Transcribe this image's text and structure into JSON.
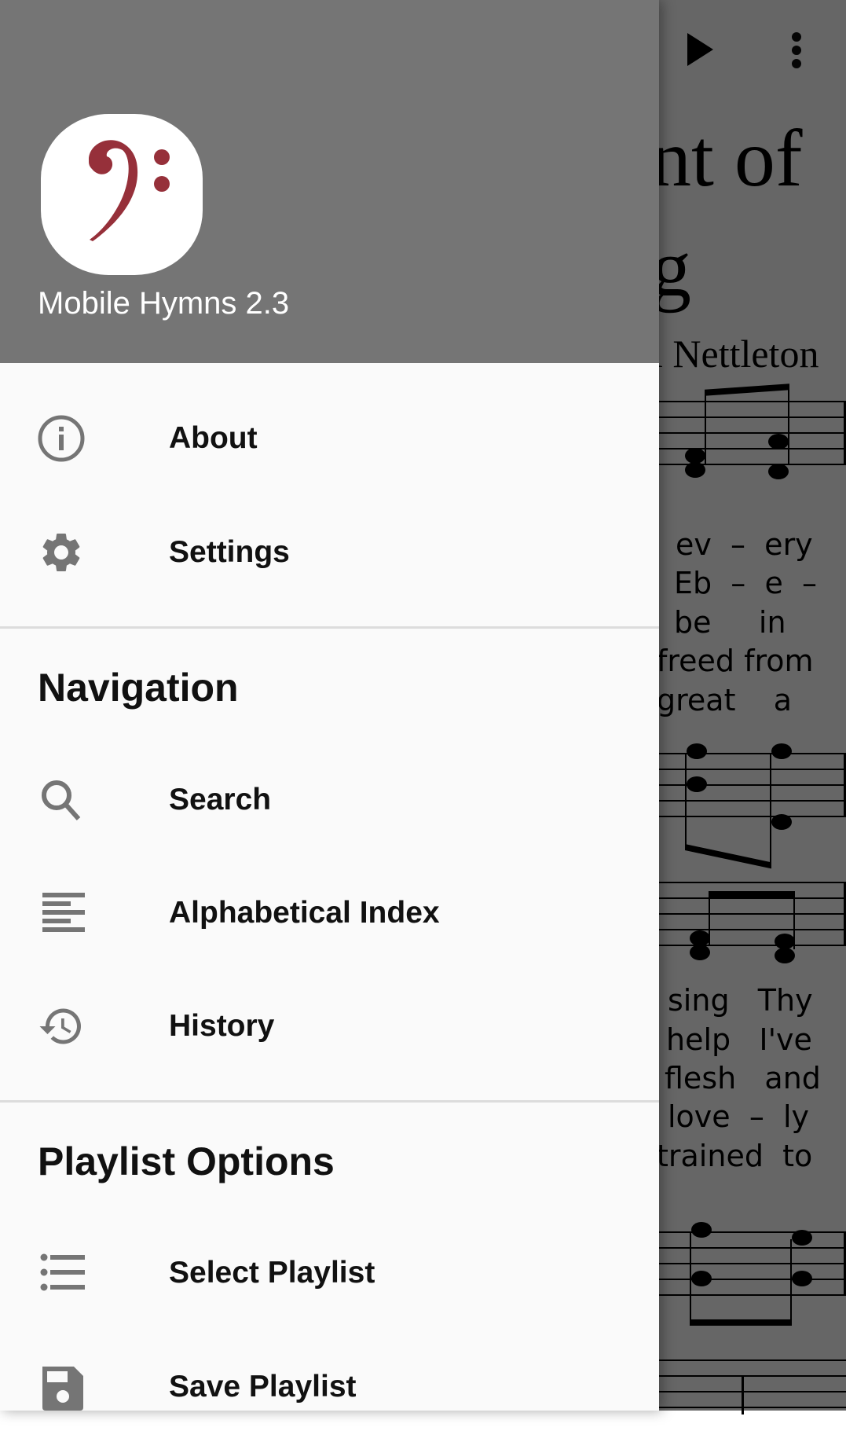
{
  "background_page": {
    "toolbar": {
      "play_icon": "play-icon",
      "overflow_icon": "more-vert-icon"
    },
    "hymn_title_line1": "nt of",
    "hymn_title_line2": "g",
    "hymn_author": "l Nettleton",
    "lyrics_block1": [
      "ev  –  ery",
      "Eb  –  e  –",
      "be     in",
      "freed from",
      "great    a"
    ],
    "lyrics_block2": [
      "sing   Thy",
      "help   I've",
      "flesh   and",
      "love  –  ly",
      "trained  to"
    ]
  },
  "drawer": {
    "header": {
      "app_icon": "bass-clef-icon",
      "app_icon_color": "#96303a",
      "title": "Mobile Hymns 2.3",
      "background_color": "#757575"
    },
    "top_items": [
      {
        "label": "About",
        "icon": "info-icon"
      },
      {
        "label": "Settings",
        "icon": "gear-icon"
      }
    ],
    "sections": [
      {
        "title": "Navigation",
        "items": [
          {
            "label": "Search",
            "icon": "search-icon"
          },
          {
            "label": "Alphabetical Index",
            "icon": "text-align-left-icon"
          },
          {
            "label": "History",
            "icon": "history-icon"
          }
        ]
      },
      {
        "title": "Playlist Options",
        "items": [
          {
            "label": "Select Playlist",
            "icon": "format-list-bulleted-icon"
          },
          {
            "label": "Save Playlist",
            "icon": "save-icon"
          }
        ]
      }
    ],
    "icon_color": "#757575"
  }
}
